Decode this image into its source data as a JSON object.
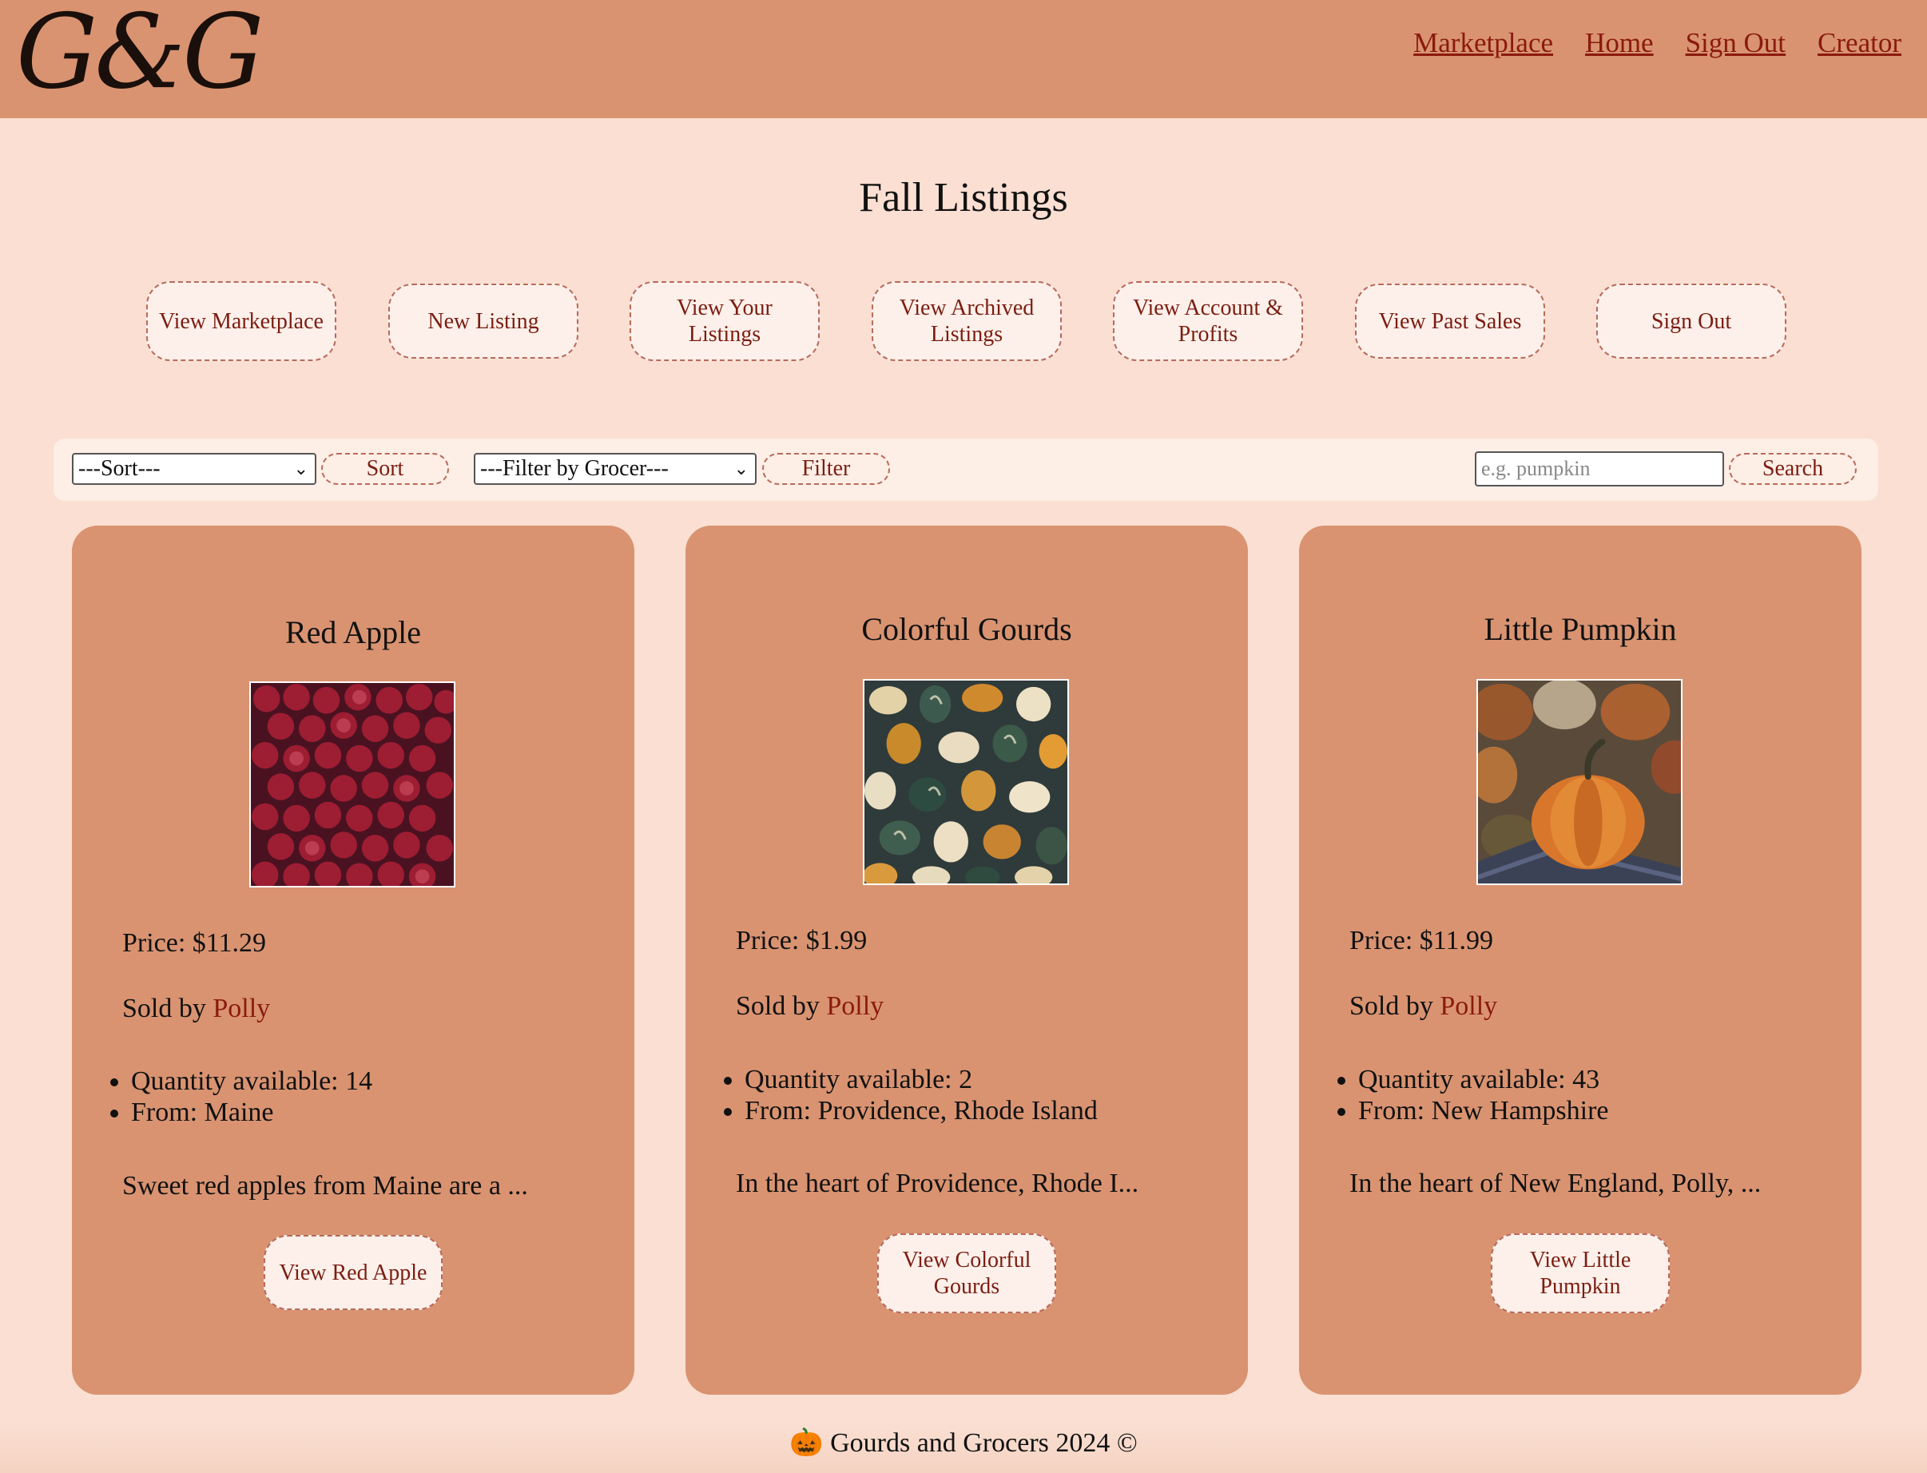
{
  "header": {
    "logo": "G&G",
    "nav": [
      "Marketplace",
      "Home",
      "Sign Out",
      "Creator"
    ]
  },
  "page_title": "Fall Listings",
  "actions": [
    "View Marketplace",
    "New Listing",
    "View Your Listings",
    "View Archived Listings",
    "View Account & Profits",
    "View Past Sales",
    "Sign Out"
  ],
  "toolbar": {
    "sort_select": "---Sort---",
    "sort_button": "Sort",
    "filter_select": "---Filter by Grocer---",
    "filter_button": "Filter",
    "search_placeholder": "e.g. pumpkin",
    "search_button": "Search"
  },
  "listings": [
    {
      "title": "Red Apple",
      "price": "Price: $11.29",
      "sold_by": "Sold by ",
      "seller": "Polly",
      "quantity": "Quantity available: 14",
      "from": "From: Maine",
      "description": "Sweet red apples from Maine are a ...",
      "button": "View Red Apple",
      "image": "red-apples-photo"
    },
    {
      "title": "Colorful Gourds",
      "price": "Price: $1.99",
      "sold_by": "Sold by ",
      "seller": "Polly",
      "quantity": "Quantity available: 2",
      "from": "From: Providence, Rhode Island",
      "description": "In the heart of Providence, Rhode I...",
      "button": "View Colorful Gourds",
      "image": "colorful-gourds-photo"
    },
    {
      "title": "Little Pumpkin",
      "price": "Price: $11.99",
      "sold_by": "Sold by ",
      "seller": "Polly",
      "quantity": "Quantity available: 43",
      "from": "From: New Hampshire",
      "description": "In the heart of New England, Polly, ...",
      "button": "View Little Pumpkin",
      "image": "little-pumpkin-photo"
    }
  ],
  "footer": "🎃 Gourds and Grocers 2024 ©",
  "colors": {
    "header_bg": "#d99371",
    "page_bg": "#fadfd2",
    "link": "#8b1a0e",
    "button_bg": "#fdf0ea"
  }
}
